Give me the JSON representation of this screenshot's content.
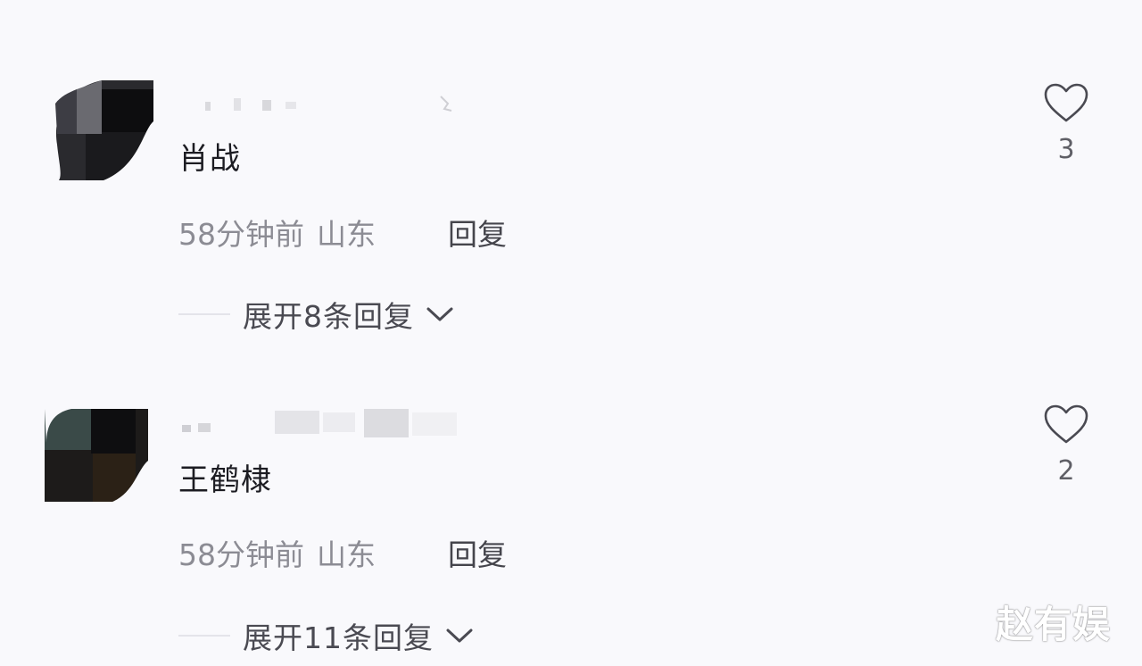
{
  "comments": [
    {
      "content": "肖战",
      "time": "58分钟前",
      "location": "山东",
      "reply_label": "回复",
      "expand_label": "展开8条回复",
      "like_count": "3"
    },
    {
      "content": "王鹤棣",
      "time": "58分钟前",
      "location": "山东",
      "reply_label": "回复",
      "expand_label": "展开11条回复",
      "like_count": "2"
    }
  ],
  "watermark": "赵有娱",
  "icons": {
    "like": "heart-outline-icon",
    "expand": "chevron-down-icon"
  },
  "colors": {
    "background": "#f9f9fc",
    "text_primary": "#1c1c22",
    "text_secondary": "#8c8c94",
    "icon": "#4a4a52"
  }
}
